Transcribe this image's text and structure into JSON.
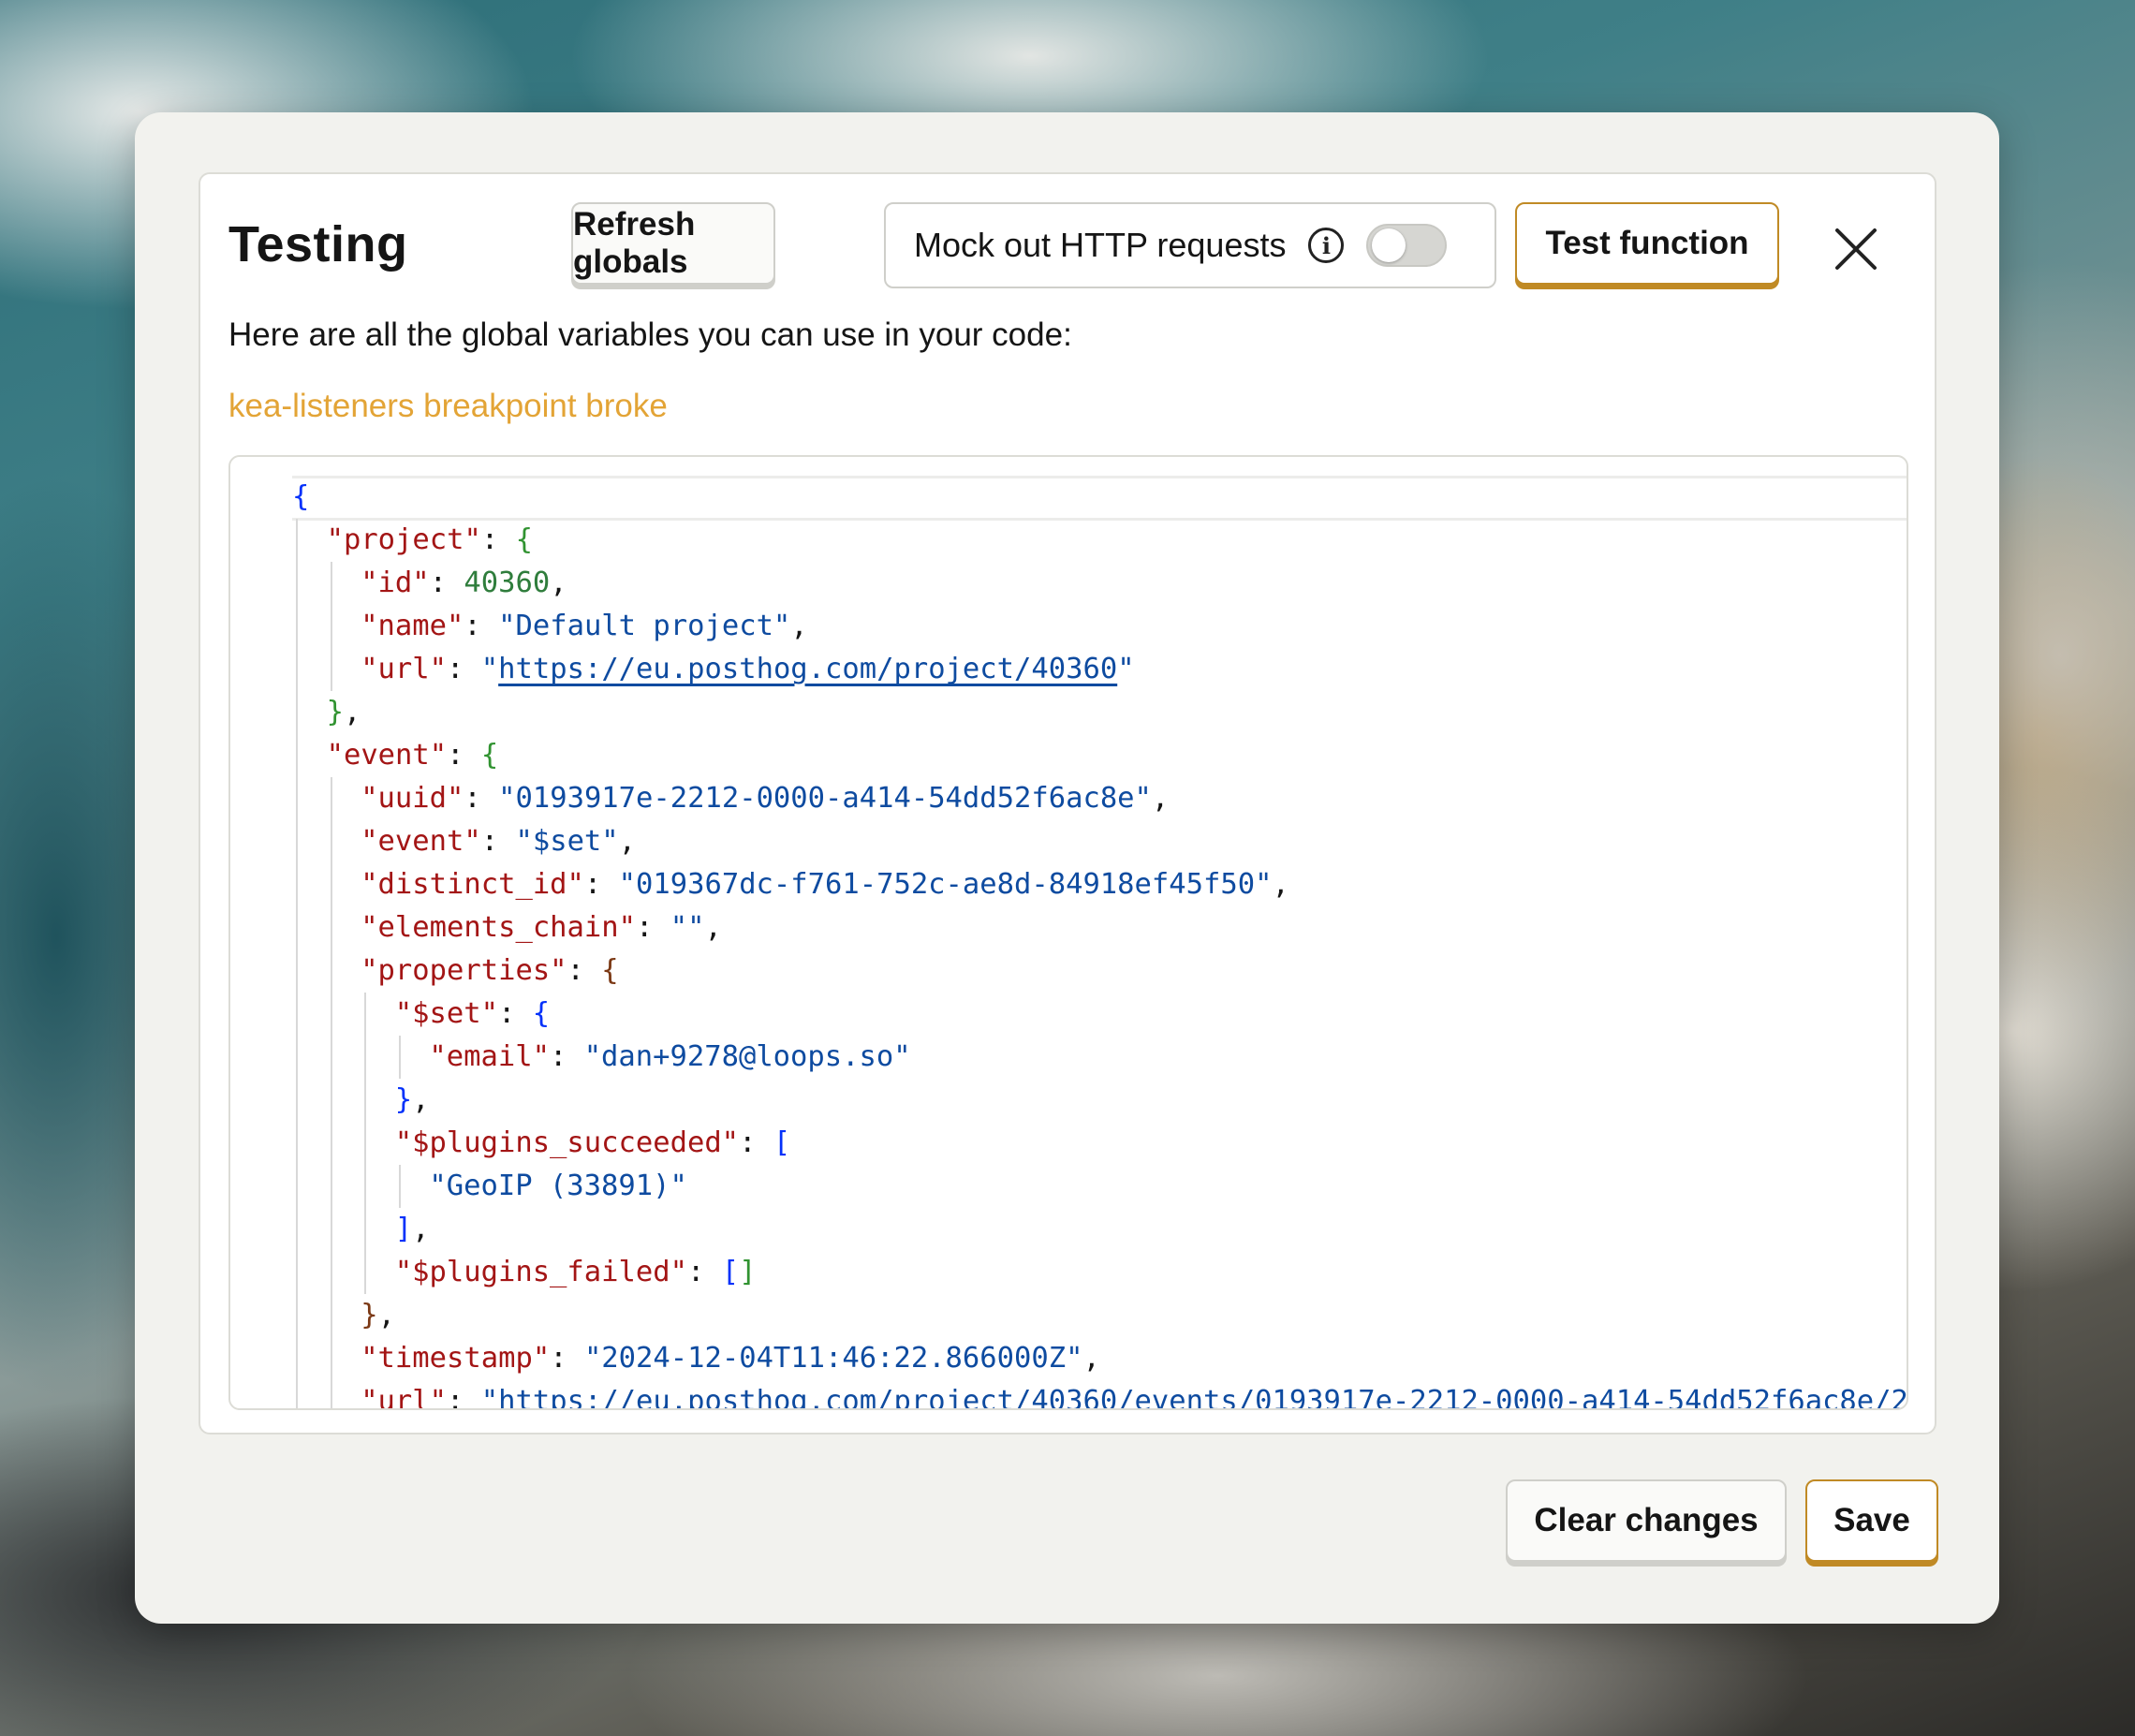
{
  "panel": {
    "title": "Testing",
    "refresh_label": "Refresh globals",
    "mock_label": "Mock out HTTP requests",
    "mock_enabled": false,
    "test_label": "Test function",
    "description": "Here are all the global variables you can use in your code:",
    "warning": "kea-listeners breakpoint broke"
  },
  "editor": {
    "lines": [
      "{",
      "\"project\": {",
      "\"id\": 40360,",
      "\"name\": \"Default project\",",
      "\"url\": \"https://eu.posthog.com/project/40360\"",
      "},",
      "\"event\": {",
      "\"uuid\": \"0193917e-2212-0000-a414-54dd52f6ac8e\",",
      "\"event\": \"$set\",",
      "\"distinct_id\": \"019367dc-f761-752c-ae8d-84918ef45f50\",",
      "\"elements_chain\": \"\",",
      "\"properties\": {",
      "\"$set\": {",
      "\"email\": \"dan+9278@loops.so\"",
      "},",
      "\"$plugins_succeeded\": [",
      "\"GeoIP (33891)\"",
      "],",
      "\"$plugins_failed\": []",
      "},",
      "\"timestamp\": \"2024-12-04T11:46:22.866000Z\",",
      "\"url\": \"https://eu.posthog.com/project/40360/events/0193917e-2212-0000-a414-54dd52f6ac8e/2"
    ]
  },
  "footer": {
    "clear_label": "Clear changes",
    "save_label": "Save"
  },
  "colors": {
    "accent": "#c08a25",
    "warning": "#e3a436",
    "json_key": "#a31515",
    "json_string": "#0e4ba0",
    "json_number": "#2f7d3c"
  }
}
